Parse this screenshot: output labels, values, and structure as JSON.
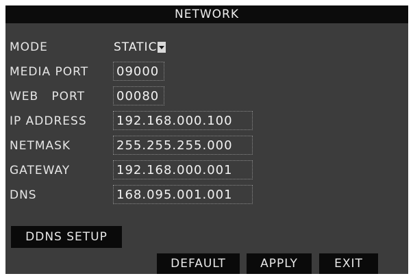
{
  "window": {
    "title": "NETWORK"
  },
  "form": {
    "mode": {
      "label": "MODE",
      "value": "STATIC"
    },
    "media_port": {
      "label": "MEDIA PORT",
      "value": "09000"
    },
    "web_port": {
      "label": "WEB   PORT",
      "value": "00080"
    },
    "ip_address": {
      "label": "IP ADDRESS",
      "value": "192.168.000.100"
    },
    "netmask": {
      "label": "NETMASK",
      "value": "255.255.255.000"
    },
    "gateway": {
      "label": "GATEWAY",
      "value": "192.168.000.001"
    },
    "dns": {
      "label": "DNS",
      "value": "168.095.001.001"
    }
  },
  "buttons": {
    "ddns_setup": "DDNS SETUP",
    "default": "DEFAULT",
    "apply": "APPLY",
    "exit": "EXIT"
  },
  "icons": {
    "mode_dropdown": "chevron-down-icon"
  },
  "colors": {
    "panel_background": "#3c3c3c",
    "titlebar_background": "#0c0c0c",
    "button_background": "#0a0a0a",
    "text": "#e6e6e6"
  }
}
